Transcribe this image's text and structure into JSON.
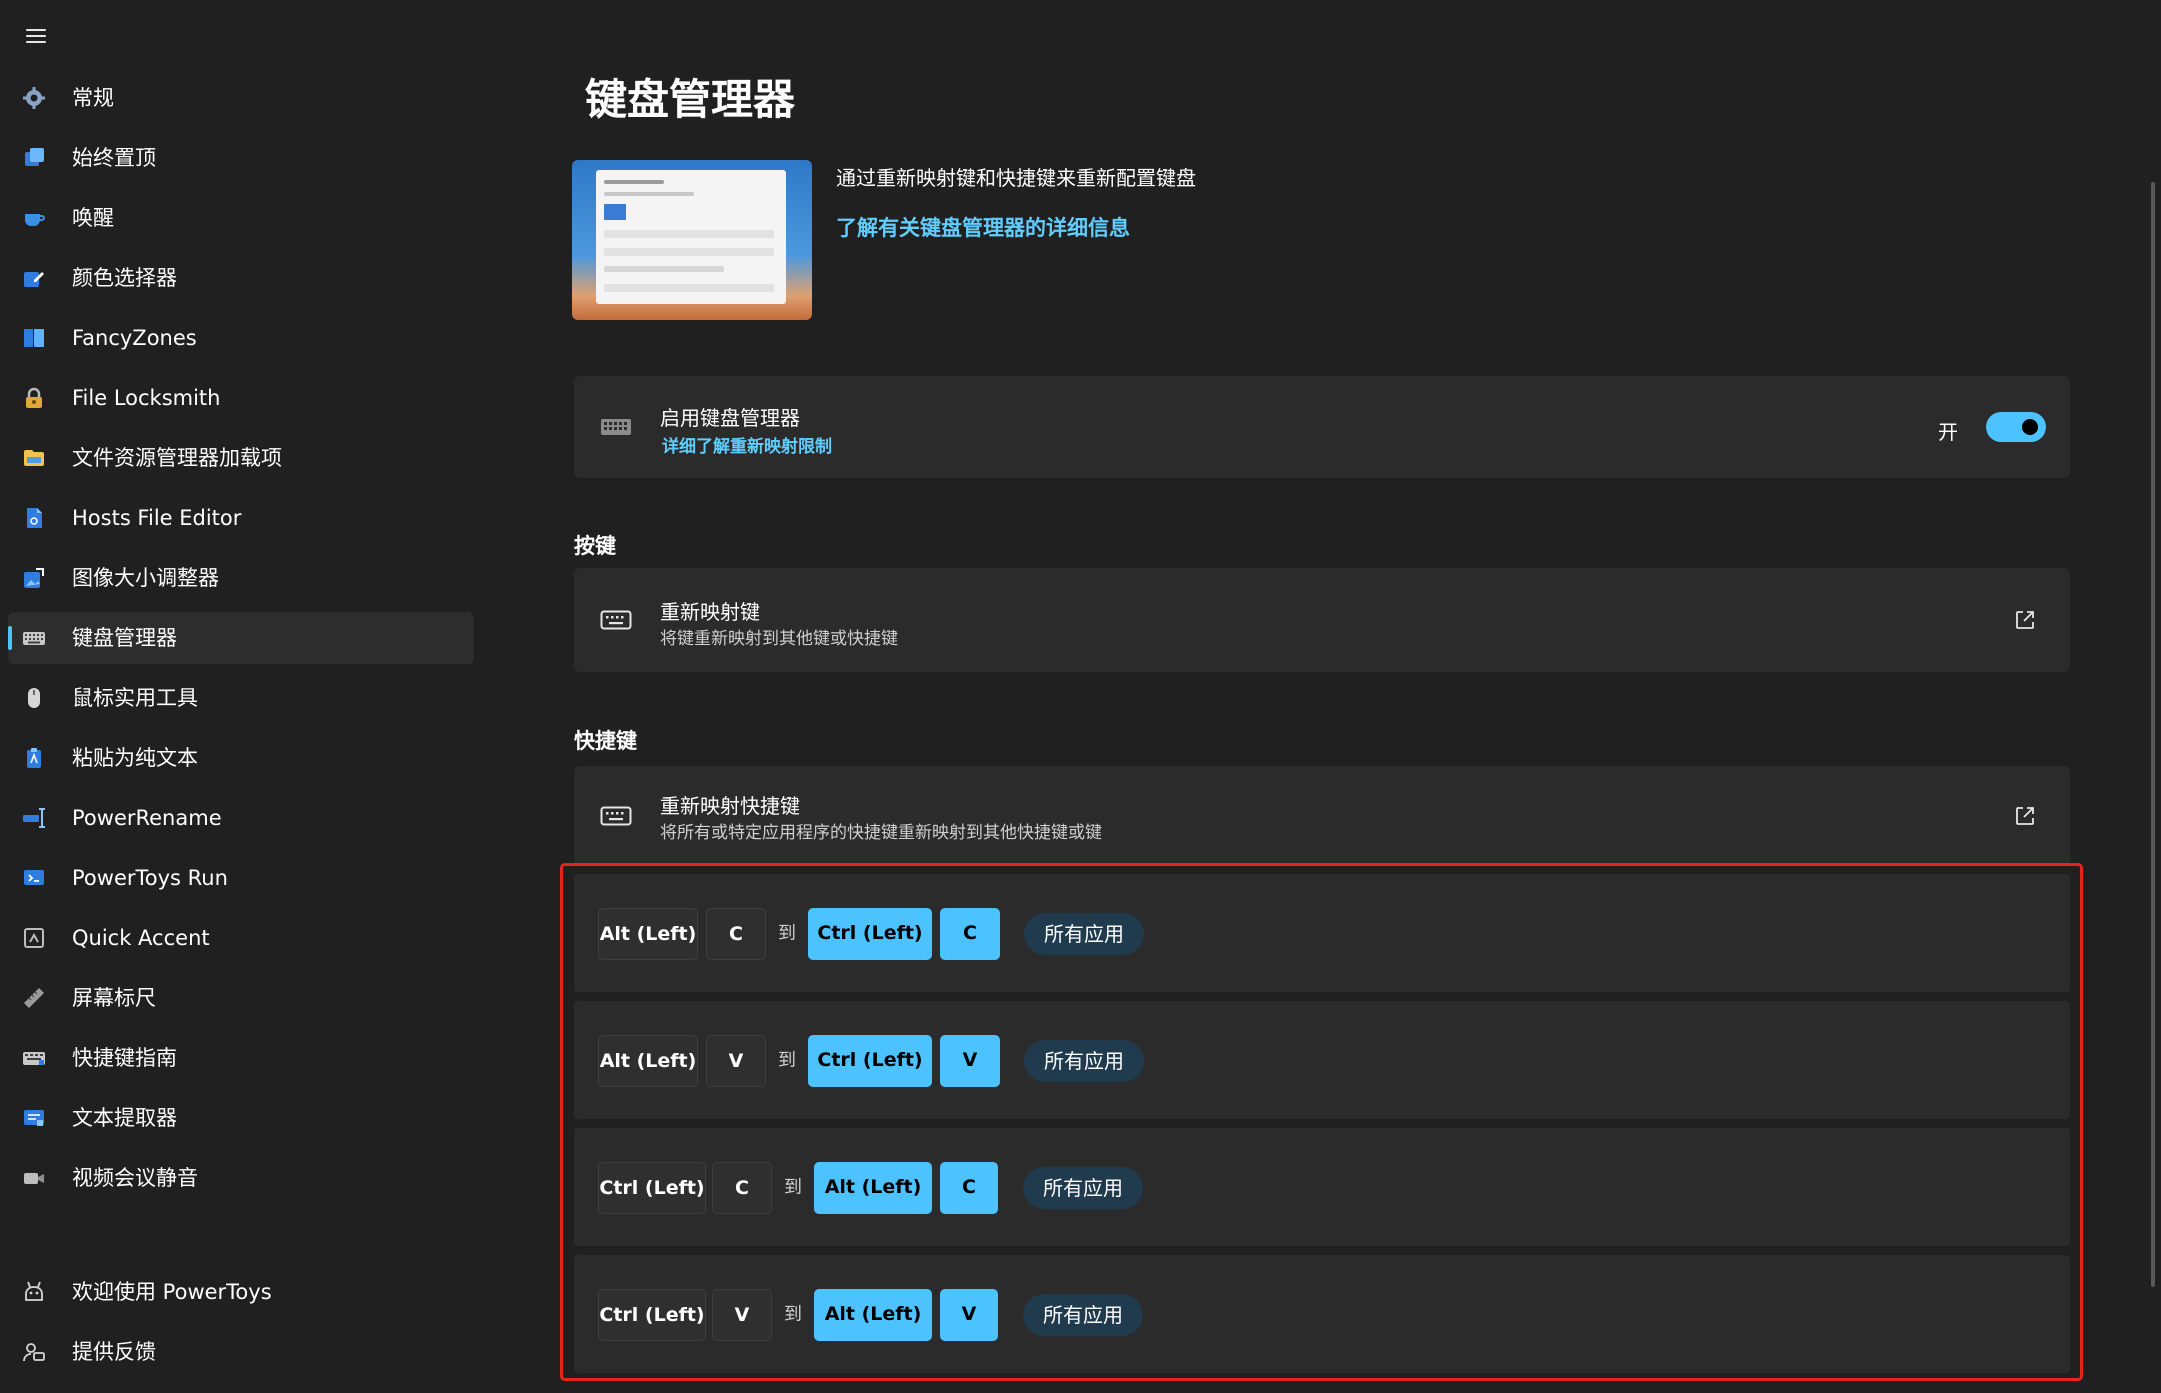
{
  "sidebar": {
    "items": [
      {
        "label": "常规",
        "icon": "gear-icon"
      },
      {
        "label": "始终置顶",
        "icon": "always-on-top-icon"
      },
      {
        "label": "唤醒",
        "icon": "awake-cup-icon"
      },
      {
        "label": "颜色选择器",
        "icon": "color-picker-icon"
      },
      {
        "label": "FancyZones",
        "icon": "fancyzones-icon"
      },
      {
        "label": "File Locksmith",
        "icon": "lock-icon"
      },
      {
        "label": "文件资源管理器加载项",
        "icon": "folder-icon"
      },
      {
        "label": "Hosts File Editor",
        "icon": "hosts-file-icon"
      },
      {
        "label": "图像大小调整器",
        "icon": "image-resizer-icon"
      },
      {
        "label": "键盘管理器",
        "icon": "keyboard-icon"
      },
      {
        "label": "鼠标实用工具",
        "icon": "mouse-icon"
      },
      {
        "label": "粘贴为纯文本",
        "icon": "paste-text-icon"
      },
      {
        "label": "PowerRename",
        "icon": "rename-icon"
      },
      {
        "label": "PowerToys Run",
        "icon": "run-icon"
      },
      {
        "label": "Quick Accent",
        "icon": "accent-icon"
      },
      {
        "label": "屏幕标尺",
        "icon": "ruler-icon"
      },
      {
        "label": "快捷键指南",
        "icon": "shortcut-guide-icon"
      },
      {
        "label": "文本提取器",
        "icon": "text-extractor-icon"
      },
      {
        "label": "视频会议静音",
        "icon": "video-camera-icon"
      }
    ],
    "footer": [
      {
        "label": "欢迎使用 PowerToys",
        "icon": "welcome-icon"
      },
      {
        "label": "提供反馈",
        "icon": "feedback-icon"
      }
    ],
    "selected_index": 9
  },
  "main": {
    "title": "键盘管理器",
    "description": "通过重新映射键和快捷键来重新配置键盘",
    "learn_more": "了解有关键盘管理器的详细信息",
    "enable": {
      "title": "启用键盘管理器",
      "link": "详细了解重新映射限制",
      "state_label": "开",
      "enabled": true
    },
    "keys_section": {
      "header": "按键",
      "title": "重新映射键",
      "subtitle": "将键重新映射到其他键或快捷键"
    },
    "shortcuts_section": {
      "header": "快捷键",
      "title": "重新映射快捷键",
      "subtitle": "将所有或特定应用程序的快捷键重新映射到其他快捷键或键"
    },
    "to_label": "到",
    "mappings": [
      {
        "from": [
          "Alt (Left)",
          "C"
        ],
        "to": [
          "Ctrl (Left)",
          "C"
        ],
        "app": "所有应用"
      },
      {
        "from": [
          "Alt (Left)",
          "V"
        ],
        "to": [
          "Ctrl (Left)",
          "V"
        ],
        "app": "所有应用"
      },
      {
        "from": [
          "Ctrl (Left)",
          "C"
        ],
        "to": [
          "Alt (Left)",
          "C"
        ],
        "app": "所有应用"
      },
      {
        "from": [
          "Ctrl (Left)",
          "V"
        ],
        "to": [
          "Alt (Left)",
          "V"
        ],
        "app": "所有应用"
      }
    ]
  },
  "colors": {
    "background": "#202020",
    "card": "#2b2b2b",
    "accent": "#4cc2ff",
    "link": "#60cdff",
    "highlight_border": "#e8231d"
  }
}
